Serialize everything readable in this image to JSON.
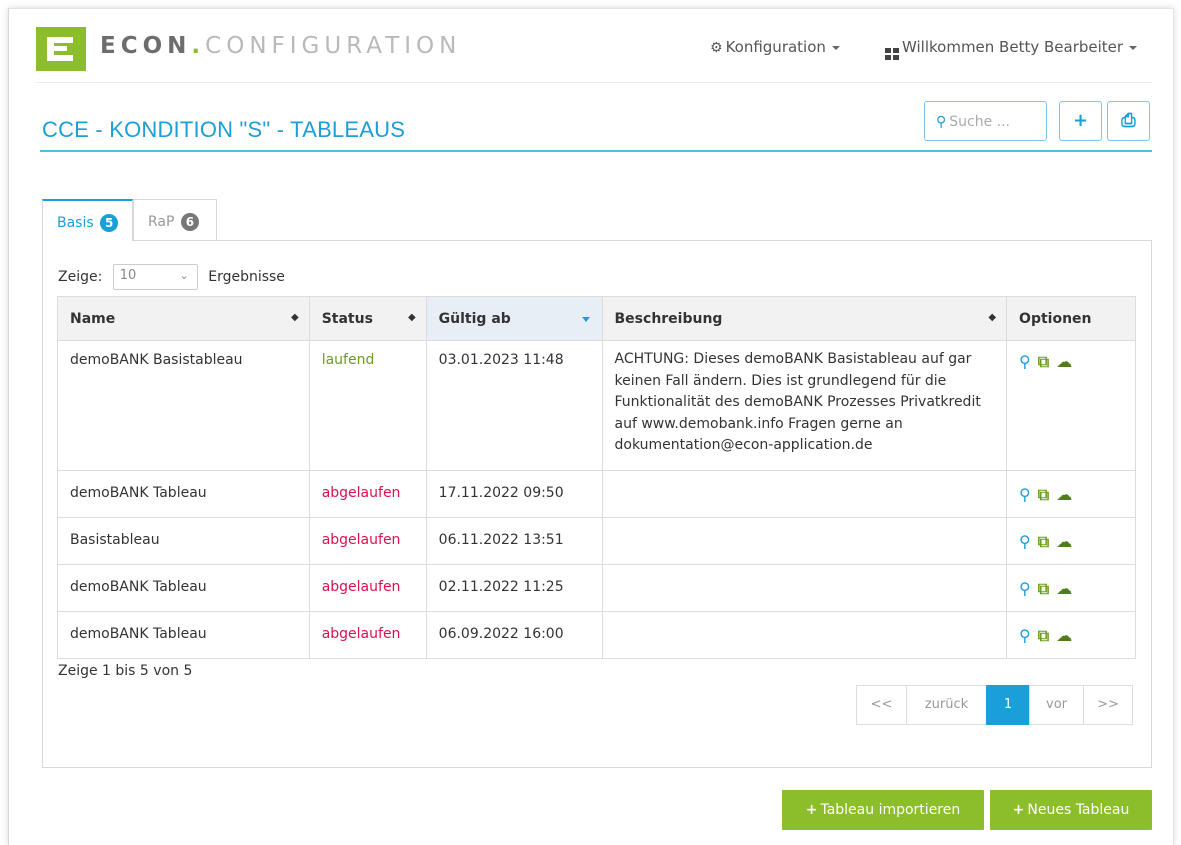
{
  "brand": {
    "part1": "ECON",
    "dot": ".",
    "part2": "CONFIGURATION"
  },
  "nav": {
    "config_label": "Konfiguration",
    "user_label": "Willkommen Betty Bearbeiter"
  },
  "page": {
    "title": "CCE - KONDITION \"S\" - TABLEAUS"
  },
  "search": {
    "placeholder": "Suche ..."
  },
  "toolbar": {
    "add_glyph": "+",
    "print_glyph": "⎙"
  },
  "tabs": [
    {
      "label": "Basis",
      "count": "5",
      "active": true
    },
    {
      "label": "RaP",
      "count": "6",
      "active": false
    }
  ],
  "length_menu": {
    "prefix": "Zeige:",
    "value": "10",
    "suffix": "Ergebnisse"
  },
  "table": {
    "columns": [
      "Name",
      "Status",
      "Gültig ab",
      "Beschreibung",
      "Optionen"
    ],
    "rows": [
      {
        "name": "demoBANK Basistableau",
        "status": "laufend",
        "valid_from": "03.01.2023 11:48",
        "description": "ACHTUNG: Dieses demoBANK Basistableau auf gar keinen Fall ändern. Dies ist grundlegend für die Funktionalität des demoBANK Prozesses Privatkredit auf www.demobank.info Fragen gerne an dokumentation@econ-application.de"
      },
      {
        "name": "demoBANK Tableau",
        "status": "abgelaufen",
        "valid_from": "17.11.2022 09:50",
        "description": ""
      },
      {
        "name": "Basistableau",
        "status": "abgelaufen",
        "valid_from": "06.11.2022 13:51",
        "description": ""
      },
      {
        "name": "demoBANK Tableau",
        "status": "abgelaufen",
        "valid_from": "02.11.2022 11:25",
        "description": ""
      },
      {
        "name": "demoBANK Tableau",
        "status": "abgelaufen",
        "valid_from": "06.09.2022 16:00",
        "description": ""
      }
    ],
    "option_icons": [
      "search-icon",
      "copy-icon",
      "cloud-download-icon"
    ]
  },
  "info": {
    "text": "Zeige 1 bis 5 von 5"
  },
  "pagination": {
    "first": "<<",
    "prev": "zurück",
    "current": "1",
    "next": "vor",
    "last": ">>"
  },
  "actions": {
    "import_label": "Tableau importieren",
    "new_label": "Neues Tableau"
  },
  "colors": {
    "brand_green": "#8cbd2a",
    "accent_blue": "#1a9fd8",
    "status_running": "#6a9c1e",
    "status_expired": "#d9124e"
  }
}
